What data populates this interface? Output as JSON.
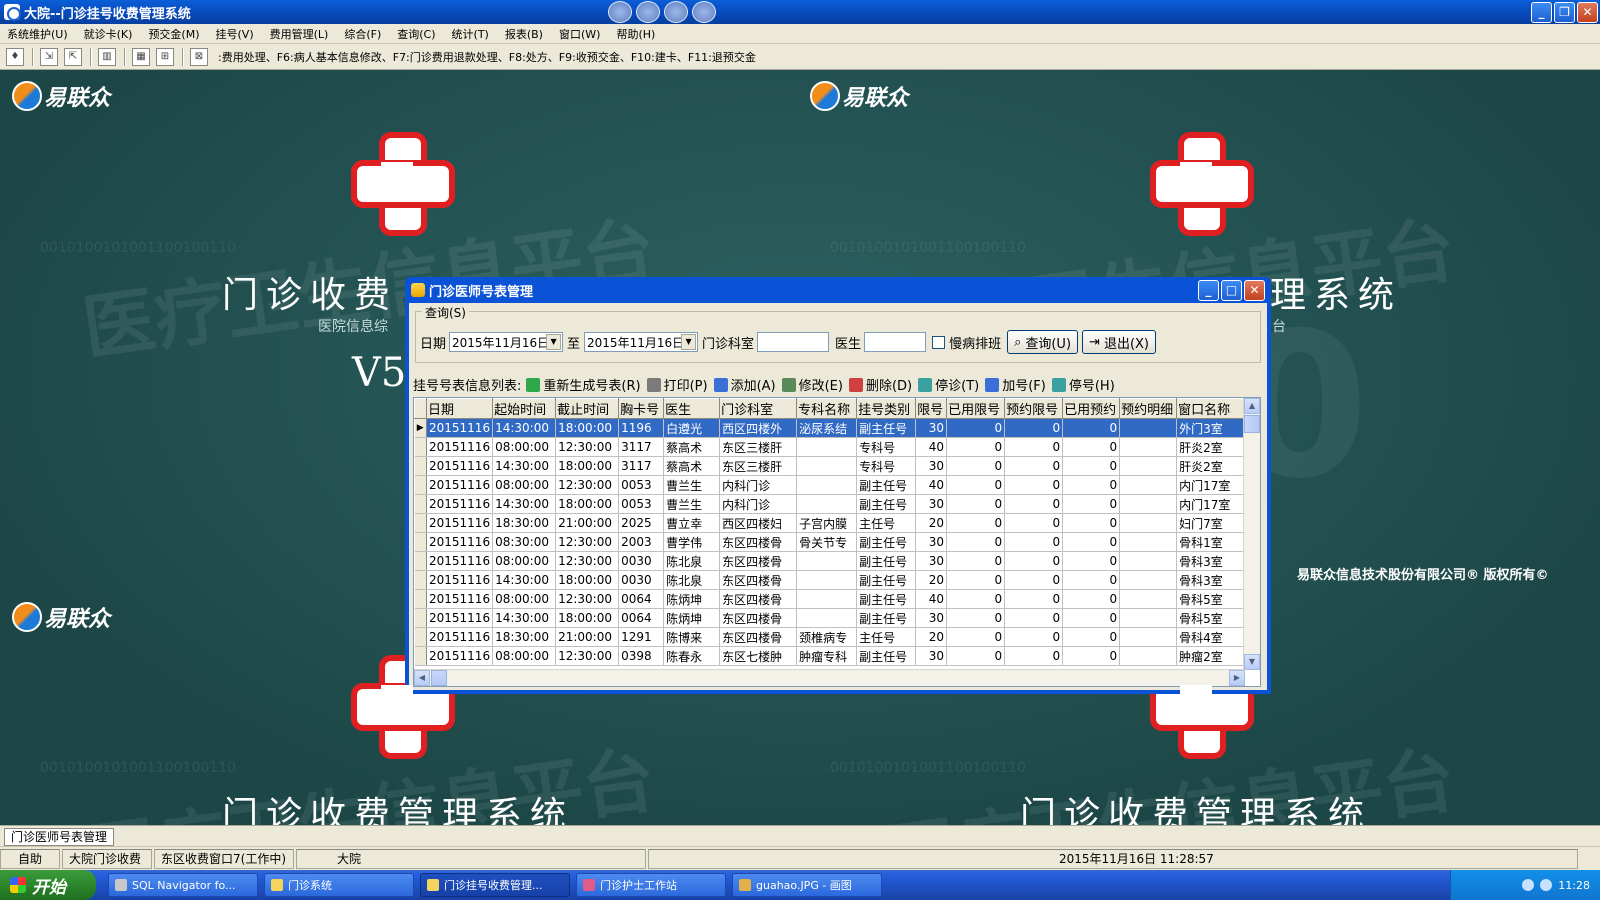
{
  "app": {
    "title": "大院--门诊挂号收费管理系统"
  },
  "menu": [
    "系统维护(U)",
    "就诊卡(K)",
    "预交金(M)",
    "挂号(V)",
    "费用管理(L)",
    "综合(F)",
    "查询(C)",
    "统计(T)",
    "报表(B)",
    "窗口(W)",
    "帮助(H)"
  ],
  "toolbar": {
    "hint": ":费用处理、F6:病人基本信息修改、F7:门诊费用退款处理、F8:处方、F9:收预交金、F10:建卡、F11:退预交金"
  },
  "background": {
    "logo_text": "易联众",
    "title_left": "门诊收费",
    "title_right": "理系统",
    "title_bottom": "门诊收费管理系统",
    "subtitle": "医院信息综",
    "subtitle_right": "台",
    "version": "V5",
    "watermark": "医疗卫生信息平台",
    "binary": "0010100101001100100110",
    "bigv": "0",
    "copyright": "易联众信息技术股份有限公司® 版权所有©"
  },
  "dialog": {
    "title": "门诊医师号表管理",
    "query_group": "查询(S)",
    "date_label": "日期",
    "date_from": "2015年11月16日",
    "to_label": "至",
    "date_to": "2015年11月16日",
    "dept_label": "门诊科室",
    "dept_value": "",
    "doctor_label": "医生",
    "doctor_value": "",
    "chronic_label": "慢病排班",
    "query_btn": "查询(U)",
    "exit_btn": "退出(X)",
    "list_label": "挂号号表信息列表:",
    "actions": [
      "重新生成号表(R)",
      "打印(P)",
      "添加(A)",
      "修改(E)",
      "删除(D)",
      "停诊(T)",
      "加号(F)",
      "停号(H)"
    ],
    "columns": [
      "日期",
      "起始时间",
      "截止时间",
      "胸卡号",
      "医生",
      "门诊科室",
      "专科名称",
      "挂号类别",
      "限号",
      "已用限号",
      "预约限号",
      "已用预约",
      "预约明细",
      "窗口名称"
    ],
    "rows": [
      [
        "20151116",
        "14:30:00",
        "18:00:00",
        "1196",
        "白遵光",
        "西区四楼外",
        "泌尿系结",
        "副主任号",
        "30",
        "0",
        "0",
        "0",
        "",
        "外门3室"
      ],
      [
        "20151116",
        "08:00:00",
        "12:30:00",
        "3117",
        "蔡高术",
        "东区三楼肝",
        "",
        "专科号",
        "40",
        "0",
        "0",
        "0",
        "",
        "肝炎2室"
      ],
      [
        "20151116",
        "14:30:00",
        "18:00:00",
        "3117",
        "蔡高术",
        "东区三楼肝",
        "",
        "专科号",
        "30",
        "0",
        "0",
        "0",
        "",
        "肝炎2室"
      ],
      [
        "20151116",
        "08:00:00",
        "12:30:00",
        "0053",
        "曹兰生",
        "内科门诊",
        "",
        "副主任号",
        "40",
        "0",
        "0",
        "0",
        "",
        "内门17室"
      ],
      [
        "20151116",
        "14:30:00",
        "18:00:00",
        "0053",
        "曹兰生",
        "内科门诊",
        "",
        "副主任号",
        "30",
        "0",
        "0",
        "0",
        "",
        "内门17室"
      ],
      [
        "20151116",
        "18:30:00",
        "21:00:00",
        "2025",
        "曹立幸",
        "西区四楼妇",
        "子宫内膜",
        "主任号",
        "20",
        "0",
        "0",
        "0",
        "",
        "妇门7室"
      ],
      [
        "20151116",
        "08:30:00",
        "12:30:00",
        "2003",
        "曹学伟",
        "东区四楼骨",
        "骨关节专",
        "副主任号",
        "30",
        "0",
        "0",
        "0",
        "",
        "骨科1室"
      ],
      [
        "20151116",
        "08:00:00",
        "12:30:00",
        "0030",
        "陈北泉",
        "东区四楼骨",
        "",
        "副主任号",
        "30",
        "0",
        "0",
        "0",
        "",
        "骨科3室"
      ],
      [
        "20151116",
        "14:30:00",
        "18:00:00",
        "0030",
        "陈北泉",
        "东区四楼骨",
        "",
        "副主任号",
        "20",
        "0",
        "0",
        "0",
        "",
        "骨科3室"
      ],
      [
        "20151116",
        "08:00:00",
        "12:30:00",
        "0064",
        "陈炳坤",
        "东区四楼骨",
        "",
        "副主任号",
        "40",
        "0",
        "0",
        "0",
        "",
        "骨科5室"
      ],
      [
        "20151116",
        "14:30:00",
        "18:00:00",
        "0064",
        "陈炳坤",
        "东区四楼骨",
        "",
        "副主任号",
        "30",
        "0",
        "0",
        "0",
        "",
        "骨科5室"
      ],
      [
        "20151116",
        "18:30:00",
        "21:00:00",
        "1291",
        "陈博来",
        "东区四楼骨",
        "颈椎病专",
        "主任号",
        "20",
        "0",
        "0",
        "0",
        "",
        "骨科4室"
      ],
      [
        "20151116",
        "08:00:00",
        "12:30:00",
        "0398",
        "陈春永",
        "东区七楼肿",
        "肿瘤专科",
        "副主任号",
        "30",
        "0",
        "0",
        "0",
        "",
        "肿瘤2室"
      ]
    ]
  },
  "doctab": {
    "label": "门诊医师号表管理"
  },
  "status": {
    "mode": "自助",
    "module": "大院门诊收费",
    "window": "东区收费窗口7(工作中)",
    "hospital": "大院",
    "datetime": "2015年11月16日 11:28:57"
  },
  "taskbar": {
    "start": "开始",
    "tasks": [
      "SQL Navigator fo...",
      "门诊系统",
      "门诊挂号收费管理...",
      "门诊护士工作站",
      "guahao.JPG - 画图"
    ],
    "clock": "11:28"
  }
}
